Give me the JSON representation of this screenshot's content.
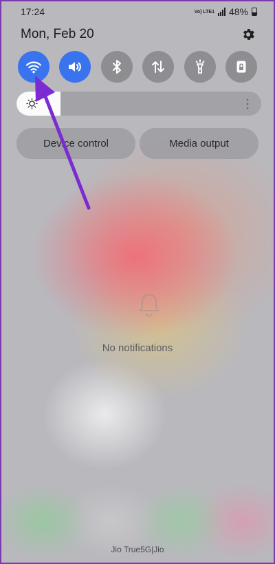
{
  "status_bar": {
    "time": "17:24",
    "network_tag": "Vo) LTE1",
    "battery": "48%"
  },
  "header": {
    "date": "Mon, Feb 20",
    "settings_icon": "gear-icon"
  },
  "quick_toggles": [
    {
      "name": "wifi",
      "icon": "wifi-icon",
      "state": "on"
    },
    {
      "name": "sound",
      "icon": "volume-icon",
      "state": "on"
    },
    {
      "name": "bluetooth",
      "icon": "bluetooth-icon",
      "state": "off"
    },
    {
      "name": "mobile-data",
      "icon": "data-transfer-icon",
      "state": "off"
    },
    {
      "name": "flashlight",
      "icon": "flashlight-icon",
      "state": "off"
    },
    {
      "name": "lock-screen",
      "icon": "lock-icon",
      "state": "off"
    }
  ],
  "brightness": {
    "level": 0.18
  },
  "buttons": {
    "device_control": "Device control",
    "media_output": "Media output"
  },
  "notifications": {
    "empty_text": "No notifications"
  },
  "footer": {
    "carrier": "Jio True5G|Jio"
  },
  "colors": {
    "toggle_on": "#3a73ee",
    "toggle_off": "#8e8d91",
    "annotation_arrow": "#7b2bd1"
  }
}
